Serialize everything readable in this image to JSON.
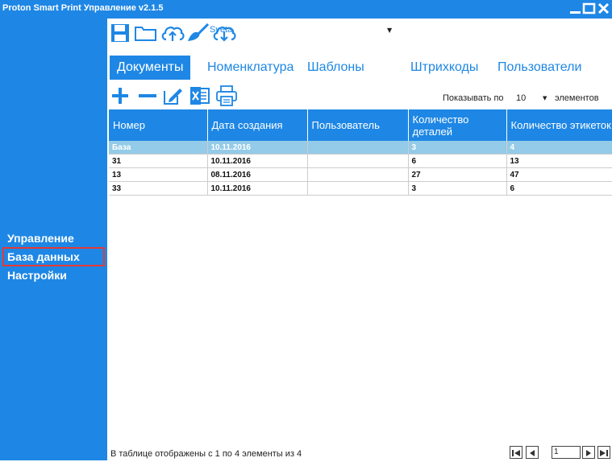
{
  "window": {
    "title": "Proton Smart Print Управление v2.1.5"
  },
  "sidebar": {
    "items": [
      "Управление",
      "База данных",
      "Настройки"
    ],
    "active_index": 1
  },
  "toolbar": {
    "user": "Sveta"
  },
  "tabs": [
    "Документы",
    "Номенклатура",
    "Шаблоны",
    "Штрихкоды",
    "Пользователи"
  ],
  "paging": {
    "show_label": "Показывать по",
    "show_count": "10",
    "show_unit": "элементов"
  },
  "table": {
    "columns": [
      "Номер",
      "Дата создания",
      "Пользователь",
      "Количество деталей",
      "Количество этикеток"
    ],
    "rows": [
      [
        "База",
        "10.11.2016",
        "",
        "3",
        "4"
      ],
      [
        "31",
        "10.11.2016",
        "",
        "6",
        "13"
      ],
      [
        "13",
        "08.11.2016",
        "",
        "27",
        "47"
      ],
      [
        "33",
        "10.11.2016",
        "",
        "3",
        "6"
      ]
    ],
    "selected_row": 0
  },
  "status": {
    "text": "В таблице отображены с 1 по 4 элементы из 4"
  },
  "pager": {
    "page": "1"
  },
  "colors": {
    "accent": "#1e87e5",
    "selected_row": "#94cbe8",
    "highlight_border": "#e53935"
  }
}
